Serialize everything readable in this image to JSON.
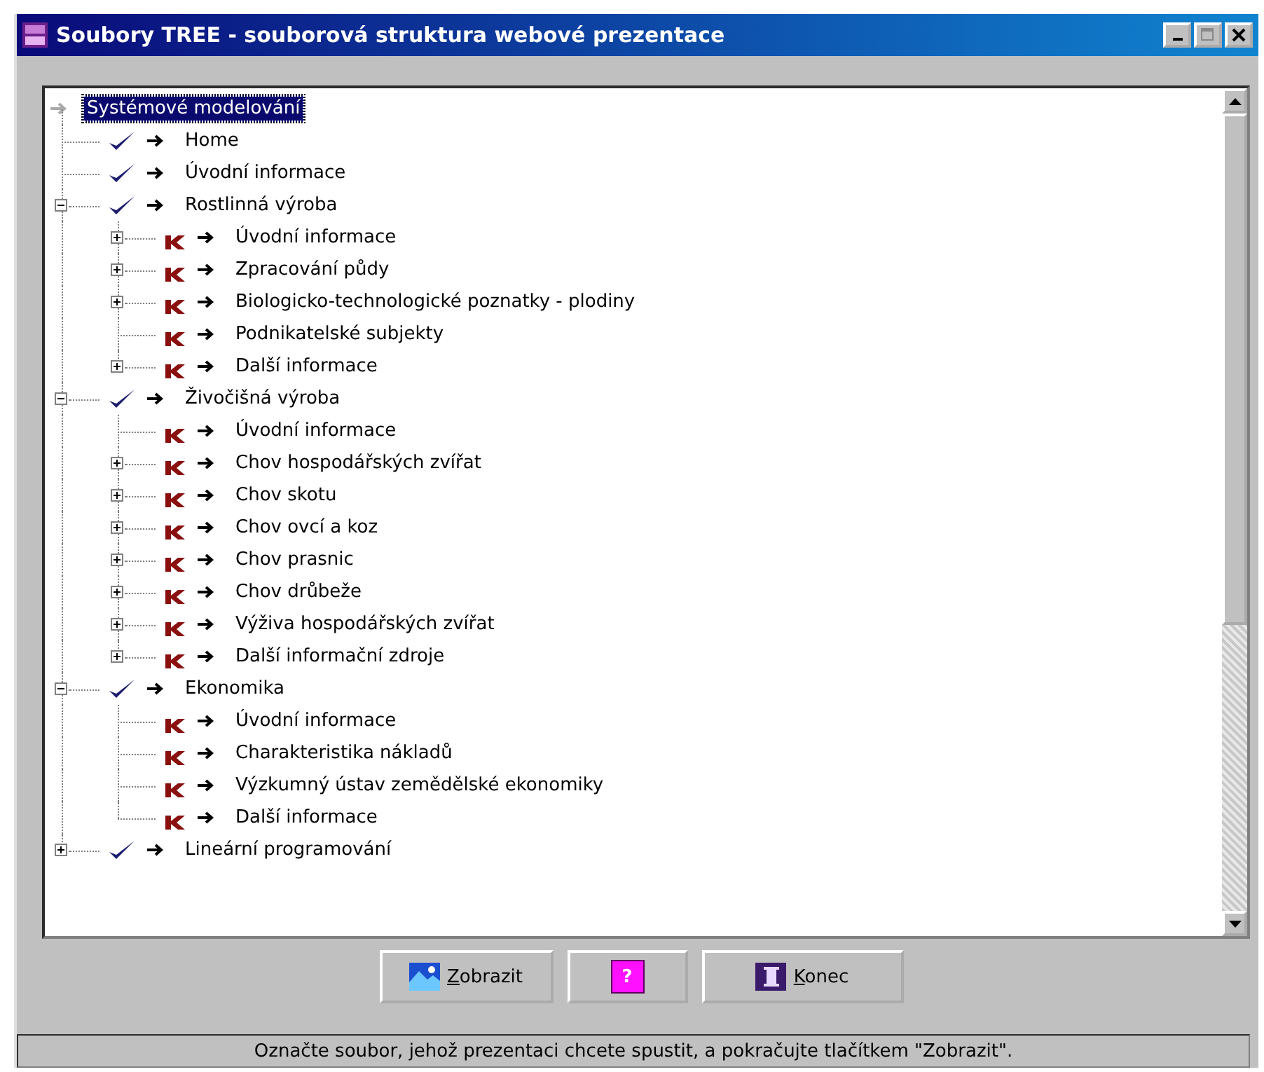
{
  "window": {
    "title": "Soubory TREE - souborová struktura webové prezentace"
  },
  "tree": {
    "label": "Systémové modelování",
    "selected": true,
    "children": [
      {
        "label": "Home",
        "kind": "check",
        "selected": false
      },
      {
        "label": "Úvodní informace",
        "kind": "check",
        "selected": false
      },
      {
        "label": "Rostlinná výroba",
        "kind": "check",
        "selected": false,
        "expanded": true,
        "children": [
          {
            "label": "Úvodní informace",
            "kind": "k",
            "selected": false,
            "expanded": false
          },
          {
            "label": "Zpracování půdy",
            "kind": "k",
            "selected": false,
            "expanded": false
          },
          {
            "label": "Biologicko-technologické poznatky - plodiny",
            "kind": "k",
            "selected": false,
            "expanded": false
          },
          {
            "label": "Podnikatelské subjekty",
            "kind": "k",
            "selected": false
          },
          {
            "label": "Další informace",
            "kind": "k",
            "selected": false,
            "expanded": false
          }
        ]
      },
      {
        "label": "Živočišná výroba",
        "kind": "check",
        "selected": false,
        "expanded": true,
        "children": [
          {
            "label": "Úvodní informace",
            "kind": "k",
            "selected": false
          },
          {
            "label": "Chov hospodářských zvířat",
            "kind": "k",
            "selected": false,
            "expanded": false
          },
          {
            "label": "Chov skotu",
            "kind": "k",
            "selected": false,
            "expanded": false
          },
          {
            "label": "Chov ovcí a koz",
            "kind": "k",
            "selected": false,
            "expanded": false
          },
          {
            "label": "Chov prasnic",
            "kind": "k",
            "selected": false,
            "expanded": false
          },
          {
            "label": "Chov drůbeže",
            "kind": "k",
            "selected": false,
            "expanded": false
          },
          {
            "label": "Výživa hospodářských zvířat",
            "kind": "k",
            "selected": false,
            "expanded": false
          },
          {
            "label": "Další informační zdroje",
            "kind": "k",
            "selected": false,
            "expanded": false
          }
        ]
      },
      {
        "label": "Ekonomika",
        "kind": "check",
        "selected": false,
        "expanded": true,
        "children": [
          {
            "label": "Úvodní informace",
            "kind": "k",
            "selected": false
          },
          {
            "label": "Charakteristika nákladů",
            "kind": "k",
            "selected": false
          },
          {
            "label": "Výzkumný ústav zemědělské ekonomiky",
            "kind": "k",
            "selected": false
          },
          {
            "label": "Další informace",
            "kind": "k",
            "selected": false
          }
        ]
      },
      {
        "label": "Lineární programování",
        "kind": "check",
        "selected": false,
        "expanded": false
      }
    ]
  },
  "buttons": [
    {
      "label": "Zobrazit",
      "kind": "show"
    },
    {
      "label": "?",
      "kind": "help"
    },
    {
      "label": "Konec",
      "kind": "exit"
    }
  ],
  "status_bar": "Označte soubor, jehož prezentaci chcete spustit, a pokračujte tlačítkem \"Zobrazit\"."
}
